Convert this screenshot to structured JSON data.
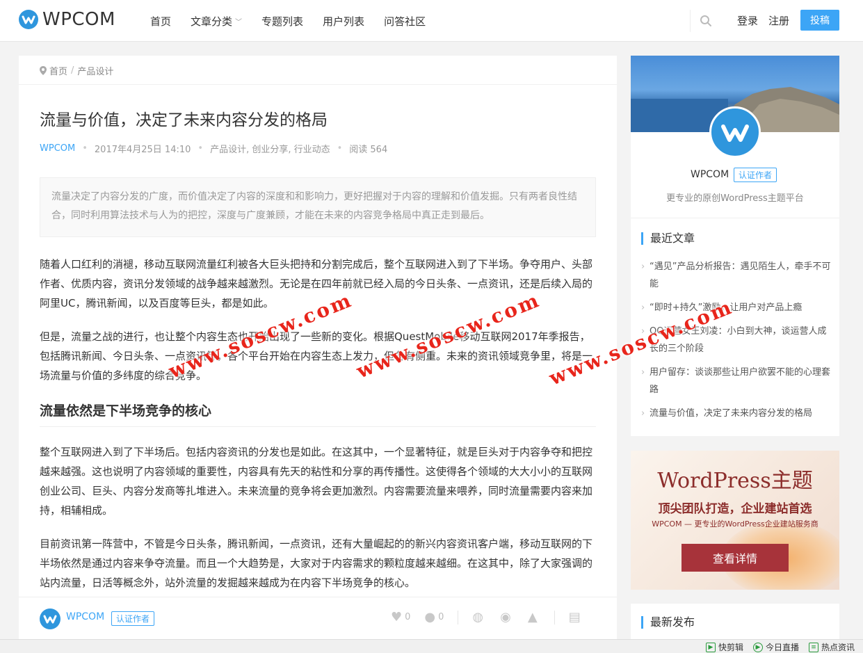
{
  "header": {
    "logo_text": "WPCOM",
    "nav": [
      {
        "label": "首页"
      },
      {
        "label": "文章分类",
        "has_dropdown": true
      },
      {
        "label": "专题列表"
      },
      {
        "label": "用户列表"
      },
      {
        "label": "问答社区"
      }
    ],
    "login": "登录",
    "register": "注册",
    "post_button": "投稿"
  },
  "breadcrumb": [
    "首页",
    "产品设计"
  ],
  "article": {
    "title": "流量与价值，决定了未来内容分发的格局",
    "author": "WPCOM",
    "date": "2017年4月25日 14:10",
    "categories": "产品设计, 创业分享, 行业动态",
    "reads": "阅读 564",
    "excerpt": "流量决定了内容分发的广度，而价值决定了内容的深度和和影响力，更好把握对于内容的理解和价值发掘。只有两者良性结合，同时利用算法技术与人为的把控，深度与广度兼顾，才能在未来的内容竞争格局中真正走到最后。",
    "p1": "随着人口红利的消褪，移动互联网流量红利被各大巨头把持和分割完成后，整个互联网进入到了下半场。争夺用户、头部作者、优质内容，资讯分发领域的战争越来越激烈。无论是在四年前就已经入局的今日头条、一点资讯，还是后续入局的阿里UC，腾讯新闻，以及百度等巨头，都是如此。",
    "p2": "但是，流量之战的进行，也让整个内容生态也开始出现了一些新的变化。根据QuestMobile移动互联网2017年季报告，包括腾讯新闻、今日头条、一点资讯等，各个平台开始在内容生态上发力，但各有侧重。未来的资讯领域竞争里，将是一场流量与价值的多纬度的综合竞争。",
    "h2": "流量依然是下半场竞争的核心",
    "p3": "整个互联网进入到了下半场后。包括内容资讯的分发也是如此。在这其中，一个显著特征，就是巨头对于内容争夺和把控越来越强。这也说明了内容领域的重要性，内容具有先天的粘性和分享的再传播性。这使得各个领域的大大小小的互联网创业公司、巨头、内容分发商等扎堆进入。未来流量的竞争将会更加激烈。内容需要流量来喂养，同时流量需要内容来加持，相辅相成。",
    "p4": "目前资讯第一阵营中，不管是今日头条，腾讯新闻，一点资讯，还有大量崛起的的新兴内容资讯客户端，移动互联网的下半场依然是通过内容来争夺流量。而且一个大趋势是，大家对于内容需求的颗粒度越来越细。在这其中，除了大家强调的站内流量，日活等概念外，站外流量的发掘越来越成为在内容下半场竞争的核心。"
  },
  "article_footer": {
    "author": "WPCOM",
    "badge": "认证作者",
    "likes": "0",
    "comments": "0"
  },
  "profile": {
    "name": "WPCOM",
    "badge": "认证作者",
    "description": "更专业的原创WordPress主题平台"
  },
  "recent": {
    "title": "最近文章",
    "items": [
      "“遇见”产品分析报告：遇见陌生人，牵手不可能",
      "“即时+持久”激励，让用户对产品上瘾",
      "QQ运营女王刘凌：小白到大神，谈运营人成长的三个阶段",
      "用户留存：谈谈那些让用户欲罢不能的心理套路",
      "流量与价值，决定了未来内容分发的格局"
    ]
  },
  "ad": {
    "title": "WordPress主题",
    "subtitle": "顶尖团队打造，企业建站首选",
    "small": "WPCOM — 更专业的WordPress企业建站服务商",
    "button": "查看详情"
  },
  "latest": {
    "title": "最新发布"
  },
  "watermark": "www.soscw.com",
  "taskbar": [
    "快剪辑",
    "今日直播",
    "热点资讯"
  ],
  "colors": {
    "accent": "#3ca5f6",
    "ad_red": "#a7333a",
    "watermark": "#e8251b"
  }
}
